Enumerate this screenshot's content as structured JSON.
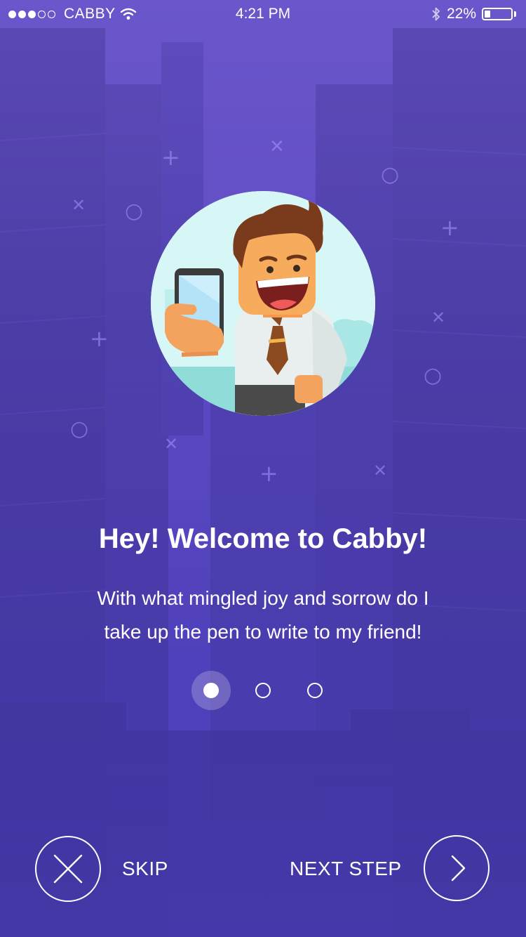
{
  "status_bar": {
    "carrier": "CABBY",
    "time": "4:21 PM",
    "battery_percent": "22%",
    "battery_level": 0.22,
    "signal_bars_filled": 3,
    "signal_bars_total": 5,
    "icons": [
      "wifi-icon",
      "bluetooth-icon",
      "battery-icon"
    ]
  },
  "onboarding": {
    "title": "Hey! Welcome to Cabby!",
    "body_line1": "With what mingled joy and sorrow do I",
    "body_line2": "take up the pen to write to my friend!",
    "pages_total": 3,
    "current_page": 1
  },
  "actions": {
    "skip_label": "SKIP",
    "next_label": "NEXT STEP",
    "skip_icon": "close-icon",
    "next_icon": "chevron-right-icon"
  },
  "colors": {
    "background_top": "#6a55c9",
    "background_bottom": "#4a3db4",
    "avatar_bg": "#d8f7f7",
    "text": "#ffffff"
  }
}
